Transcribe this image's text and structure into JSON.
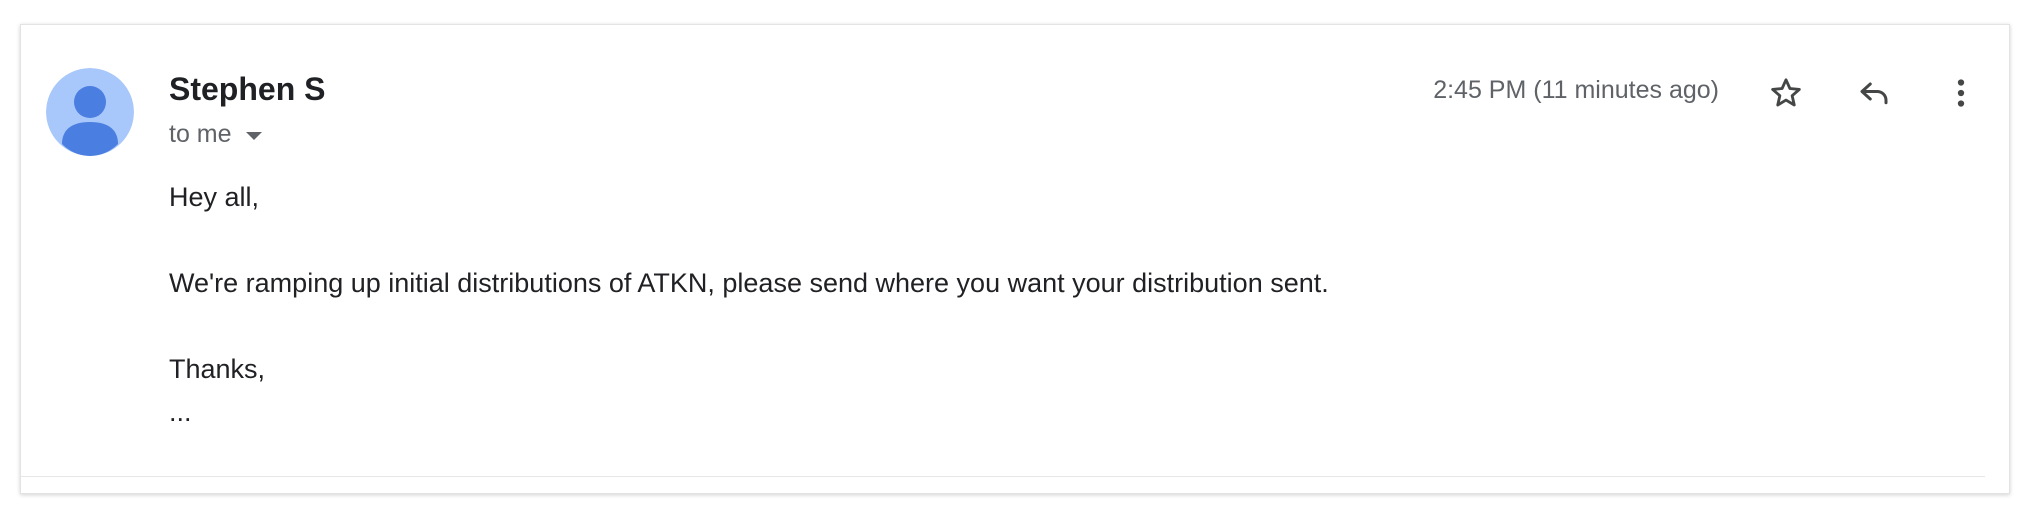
{
  "email": {
    "sender_name": "Stephen S",
    "recipient_label": "to me",
    "timestamp": "2:45 PM (11 minutes ago)",
    "body": {
      "greeting": "Hey all,",
      "paragraph": "We're ramping up initial distributions of ATKN, please send where you want your distribution sent.",
      "signoff": "Thanks,",
      "trimmed": "..."
    }
  },
  "icons": {
    "avatar": "person-avatar-icon",
    "recipient_dropdown": "caret-down-icon",
    "star": "star-outline-icon",
    "reply": "reply-icon",
    "more": "more-vertical-icon"
  },
  "colors": {
    "avatar_background": "#a8c7fa",
    "avatar_figure": "#4a7ee0",
    "text_primary": "#202124",
    "text_secondary": "#5f6368",
    "icon": "#444746"
  }
}
